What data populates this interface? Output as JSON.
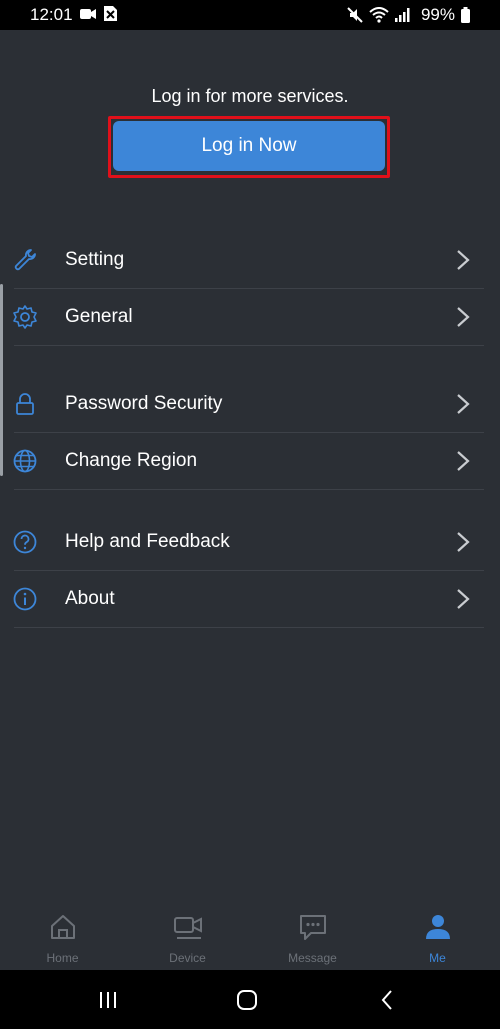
{
  "status_bar": {
    "time": "12:01",
    "battery": "99%"
  },
  "login": {
    "prompt": "Log in for more services.",
    "button_label": "Log in Now"
  },
  "menu": {
    "items": [
      {
        "id": "setting",
        "label": "Setting",
        "icon": "wrench-icon"
      },
      {
        "id": "general",
        "label": "General",
        "icon": "gear-icon"
      },
      {
        "id": "password-security",
        "label": "Password Security",
        "icon": "lock-icon"
      },
      {
        "id": "change-region",
        "label": "Change Region",
        "icon": "globe-icon"
      },
      {
        "id": "help-feedback",
        "label": "Help and Feedback",
        "icon": "question-circle-icon"
      },
      {
        "id": "about",
        "label": "About",
        "icon": "info-circle-icon"
      }
    ]
  },
  "tabs": [
    {
      "label": "Home",
      "icon": "home-icon",
      "active": false
    },
    {
      "label": "Device",
      "icon": "camera-icon",
      "active": false
    },
    {
      "label": "Message",
      "icon": "message-icon",
      "active": false
    },
    {
      "label": "Me",
      "icon": "person-icon",
      "active": true
    }
  ],
  "colors": {
    "background": "#2b2f35",
    "accent": "#3d86d8",
    "highlight": "#e0101a",
    "inactive": "#6c7178"
  }
}
